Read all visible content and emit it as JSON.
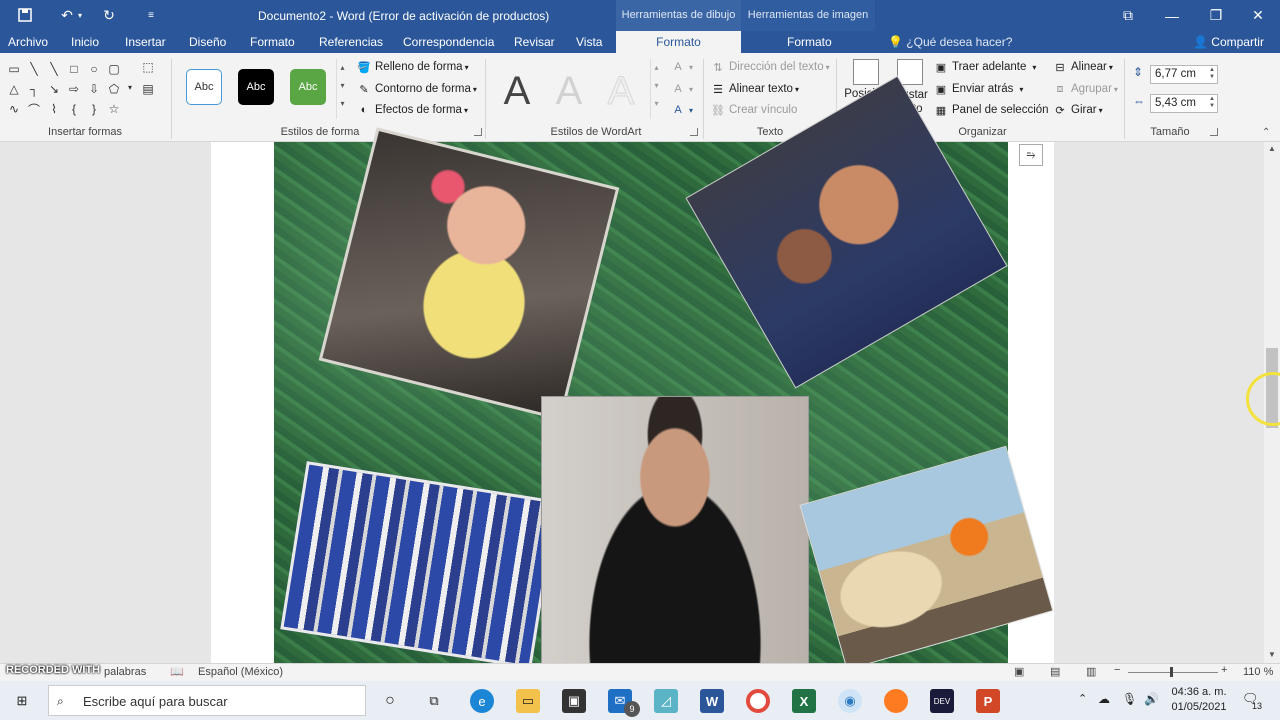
{
  "titlebar": {
    "title": "Documento2 - Word (Error de activación de productos)",
    "context_drawing": "Herramientas de dibujo",
    "context_image": "Herramientas de imagen"
  },
  "tabs": [
    "Archivo",
    "Inicio",
    "Insertar",
    "Diseño",
    "Formato",
    "Referencias",
    "Correspondencia",
    "Revisar",
    "Vista",
    "Formato",
    "Formato"
  ],
  "tell_me": "¿Qué desea hacer?",
  "share": "Compartir",
  "ribbon": {
    "groups": {
      "insert_shapes": "Insertar formas",
      "shape_styles": "Estilos de forma",
      "wordart_styles": "Estilos de WordArt",
      "text": "Texto",
      "arrange": "Organizar",
      "size": "Tamaño"
    },
    "style_samples": [
      "Abc",
      "Abc",
      "Abc"
    ],
    "shape_fill": "Relleno de forma",
    "shape_outline": "Contorno de forma",
    "shape_effects": "Efectos de forma",
    "wordart_letter": "A",
    "text_direction": "Dirección del texto",
    "align_text": "Alinear texto",
    "create_link": "Crear vínculo",
    "position": "Posición",
    "wrap_text": "Ajustar texto",
    "bring_forward": "Traer adelante",
    "send_backward": "Enviar atrás",
    "selection_pane": "Panel de selección",
    "align": "Alinear",
    "group": "Agrupar",
    "rotate": "Girar",
    "height": "6,77 cm",
    "width": "5,43 cm"
  },
  "statusbar": {
    "words": "palabras",
    "language": "Español (México)",
    "zoom": "110 %"
  },
  "watermark": "RECORDED WITH SCREENCAST-O-MATIC",
  "taskbar": {
    "search_placeholder": "Escribe aquí para buscar",
    "mail_badge": "9",
    "time": "04:36 a. m.",
    "date": "01/05/2021",
    "notif_count": "13"
  }
}
